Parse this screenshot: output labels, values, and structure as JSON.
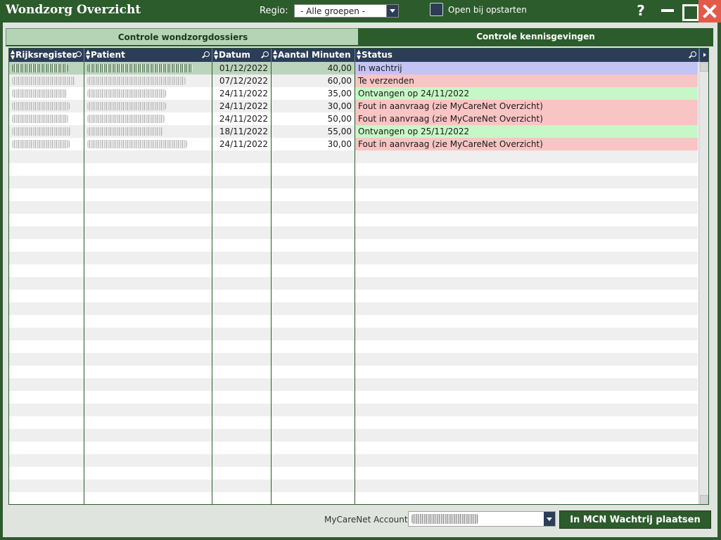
{
  "window": {
    "title": "Wondzorg Overzicht"
  },
  "titlebar": {
    "regio_label": "Regio:",
    "regio_value": "- Alle groepen -",
    "open_bij_opstarten_label": "Open bij opstarten",
    "open_bij_opstarten_checked": false,
    "help_label": "?"
  },
  "tabs": [
    {
      "label": "Controle wondzorgdossiers",
      "active": true
    },
    {
      "label": "Controle kennisgevingen",
      "active": false
    }
  ],
  "grid": {
    "columns": [
      "Rijksregister",
      "Patient",
      "Datum",
      "Aantal Minuten",
      "Status"
    ],
    "rows": [
      {
        "datum": "01/12/2022",
        "minuten": "40,00",
        "status": "In wachtrij",
        "status_color": "#c3c3f4",
        "selected": true
      },
      {
        "datum": "07/12/2022",
        "minuten": "60,00",
        "status": "Te verzenden",
        "status_color": "#f9c4c4",
        "selected": false
      },
      {
        "datum": "24/11/2022",
        "minuten": "35,00",
        "status": "Ontvangen op 24/11/2022",
        "status_color": "#c6f7c6",
        "selected": false
      },
      {
        "datum": "24/11/2022",
        "minuten": "30,00",
        "status": "Fout in aanvraag (zie MyCareNet Overzicht)",
        "status_color": "#f9c4c4",
        "selected": false
      },
      {
        "datum": "24/11/2022",
        "minuten": "50,00",
        "status": "Fout in aanvraag (zie MyCareNet Overzicht)",
        "status_color": "#f9c4c4",
        "selected": false
      },
      {
        "datum": "18/11/2022",
        "minuten": "55,00",
        "status": "Ontvangen op 25/11/2022",
        "status_color": "#c6f7c6",
        "selected": false
      },
      {
        "datum": "24/11/2022",
        "minuten": "30,00",
        "status": "Fout in aanvraag (zie MyCareNet Overzicht)",
        "status_color": "#f9c4c4",
        "selected": false
      }
    ]
  },
  "footer": {
    "account_label": "MyCareNet Account",
    "queue_button_label": "In MCN Wachtrij plaatsen"
  },
  "colors": {
    "brand_green": "#2c5b2c",
    "header_navy": "#2b3d57",
    "close_red": "#e35a4a"
  }
}
